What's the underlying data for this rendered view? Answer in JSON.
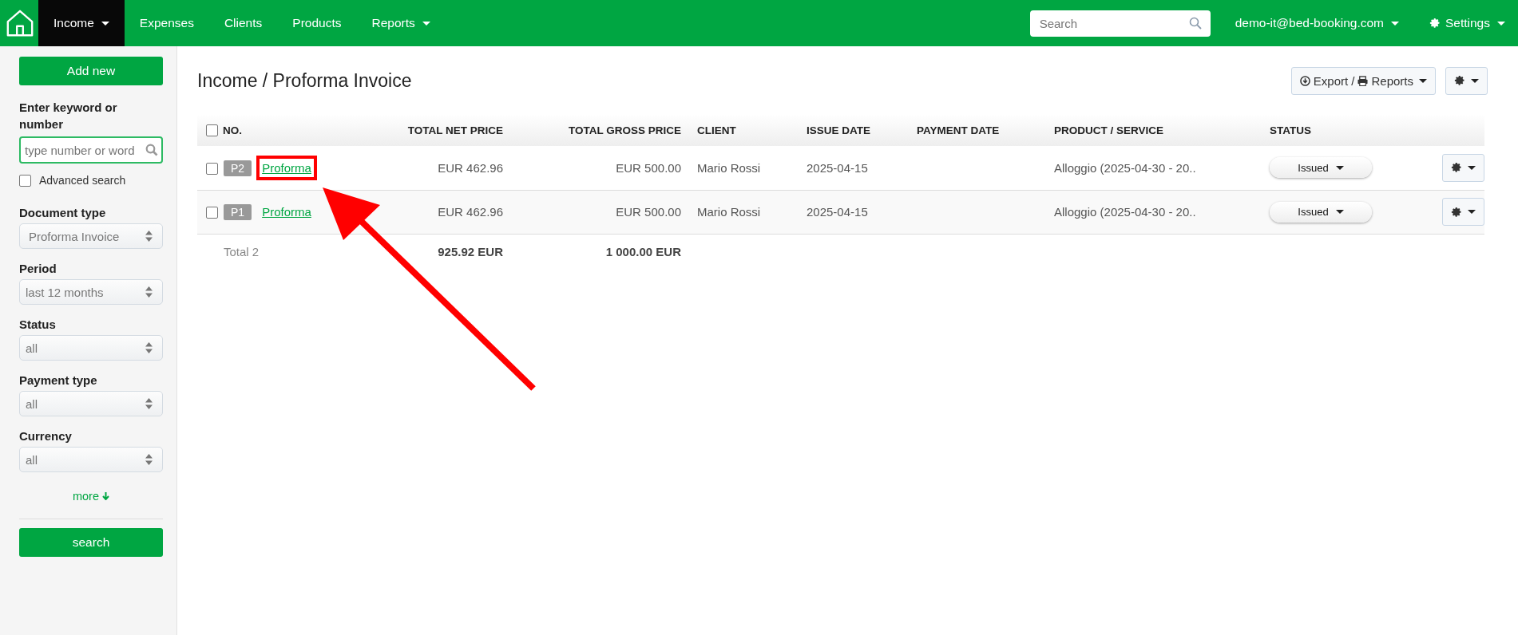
{
  "nav": {
    "items": [
      {
        "label": "Income",
        "selected": true,
        "dropdown": true
      },
      {
        "label": "Expenses",
        "selected": false,
        "dropdown": false
      },
      {
        "label": "Clients",
        "selected": false,
        "dropdown": false
      },
      {
        "label": "Products",
        "selected": false,
        "dropdown": false
      },
      {
        "label": "Reports",
        "selected": false,
        "dropdown": true
      }
    ],
    "search": {
      "placeholder": "Search"
    },
    "account": "demo-it@bed-booking.com",
    "settings": "Settings"
  },
  "sidebar": {
    "add_button": "Add new",
    "keyword_label": "Enter keyword or number",
    "keyword_placeholder": "type number or word",
    "advanced": {
      "label": "Advanced search",
      "checked": false
    },
    "filters": [
      {
        "label": "Document type",
        "value": "Proforma Invoice"
      },
      {
        "label": "Period",
        "value": "last 12 months"
      },
      {
        "label": "Status",
        "value": "all"
      },
      {
        "label": "Payment type",
        "value": "all"
      },
      {
        "label": "Currency",
        "value": "all"
      }
    ],
    "more": "more",
    "search_button": "search"
  },
  "page": {
    "title": "Income / Proforma Invoice",
    "export_label": "Export /",
    "reports_label": "Reports"
  },
  "table": {
    "select_all_checked": false,
    "columns": [
      "NO.",
      "TOTAL NET PRICE",
      "TOTAL GROSS PRICE",
      "CLIENT",
      "ISSUE DATE",
      "PAYMENT DATE",
      "PRODUCT / SERVICE",
      "STATUS"
    ],
    "rows": [
      {
        "checked": false,
        "badge": "P2",
        "number": "Proforma",
        "highlighted": true,
        "net": "EUR 462.96",
        "gross": "EUR 500.00",
        "client": "Mario Rossi",
        "issue_date": "2025-04-15",
        "product": "Alloggio (2025-04-30 - 20..",
        "status": "Issued"
      },
      {
        "checked": false,
        "badge": "P1",
        "number": "Proforma",
        "highlighted": false,
        "net": "EUR 462.96",
        "gross": "EUR 500.00",
        "client": "Mario Rossi",
        "issue_date": "2025-04-15",
        "product": "Alloggio (2025-04-30 - 20..",
        "status": "Issued"
      }
    ],
    "totals": {
      "label": "Total 2",
      "net": "925.92 EUR",
      "gross": "1 000.00 EUR"
    }
  }
}
